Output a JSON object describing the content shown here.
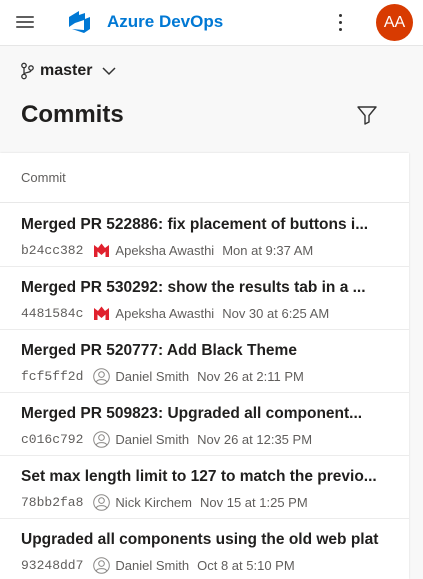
{
  "header": {
    "brand": "Azure DevOps",
    "avatar_initials": "AA",
    "avatar_color": "#d83b01",
    "brand_color": "#0078d4"
  },
  "branch": {
    "name": "master"
  },
  "page": {
    "title": "Commits"
  },
  "table": {
    "column_header": "Commit"
  },
  "commits": [
    {
      "title": "Merged PR 522886: fix placement of buttons i...",
      "hash": "b24cc382",
      "author": "Apeksha Awasthi",
      "date": "Mon at 9:37 AM",
      "avatar": "m-logo-icon"
    },
    {
      "title": "Merged PR 530292: show the results tab in a ...",
      "hash": "4481584c",
      "author": "Apeksha Awasthi",
      "date": "Nov 30 at 6:25 AM",
      "avatar": "m-logo-icon"
    },
    {
      "title": "Merged PR 520777: Add Black Theme",
      "hash": "fcf5ff2d",
      "author": "Daniel Smith",
      "date": "Nov 26 at 2:11 PM",
      "avatar": "person-icon"
    },
    {
      "title": "Merged PR 509823: Upgraded all component...",
      "hash": "c016c792",
      "author": "Daniel Smith",
      "date": "Nov 26 at 12:35 PM",
      "avatar": "person-icon"
    },
    {
      "title": "Set max length limit to 127 to match the previo...",
      "hash": "78bb2fa8",
      "author": "Nick Kirchem",
      "date": "Nov 15 at 1:25 PM",
      "avatar": "person-icon"
    },
    {
      "title": "Upgraded all components using the old web plat",
      "hash": "93248dd7",
      "author": "Daniel Smith",
      "date": "Oct 8 at 5:10 PM",
      "avatar": "person-icon"
    }
  ]
}
